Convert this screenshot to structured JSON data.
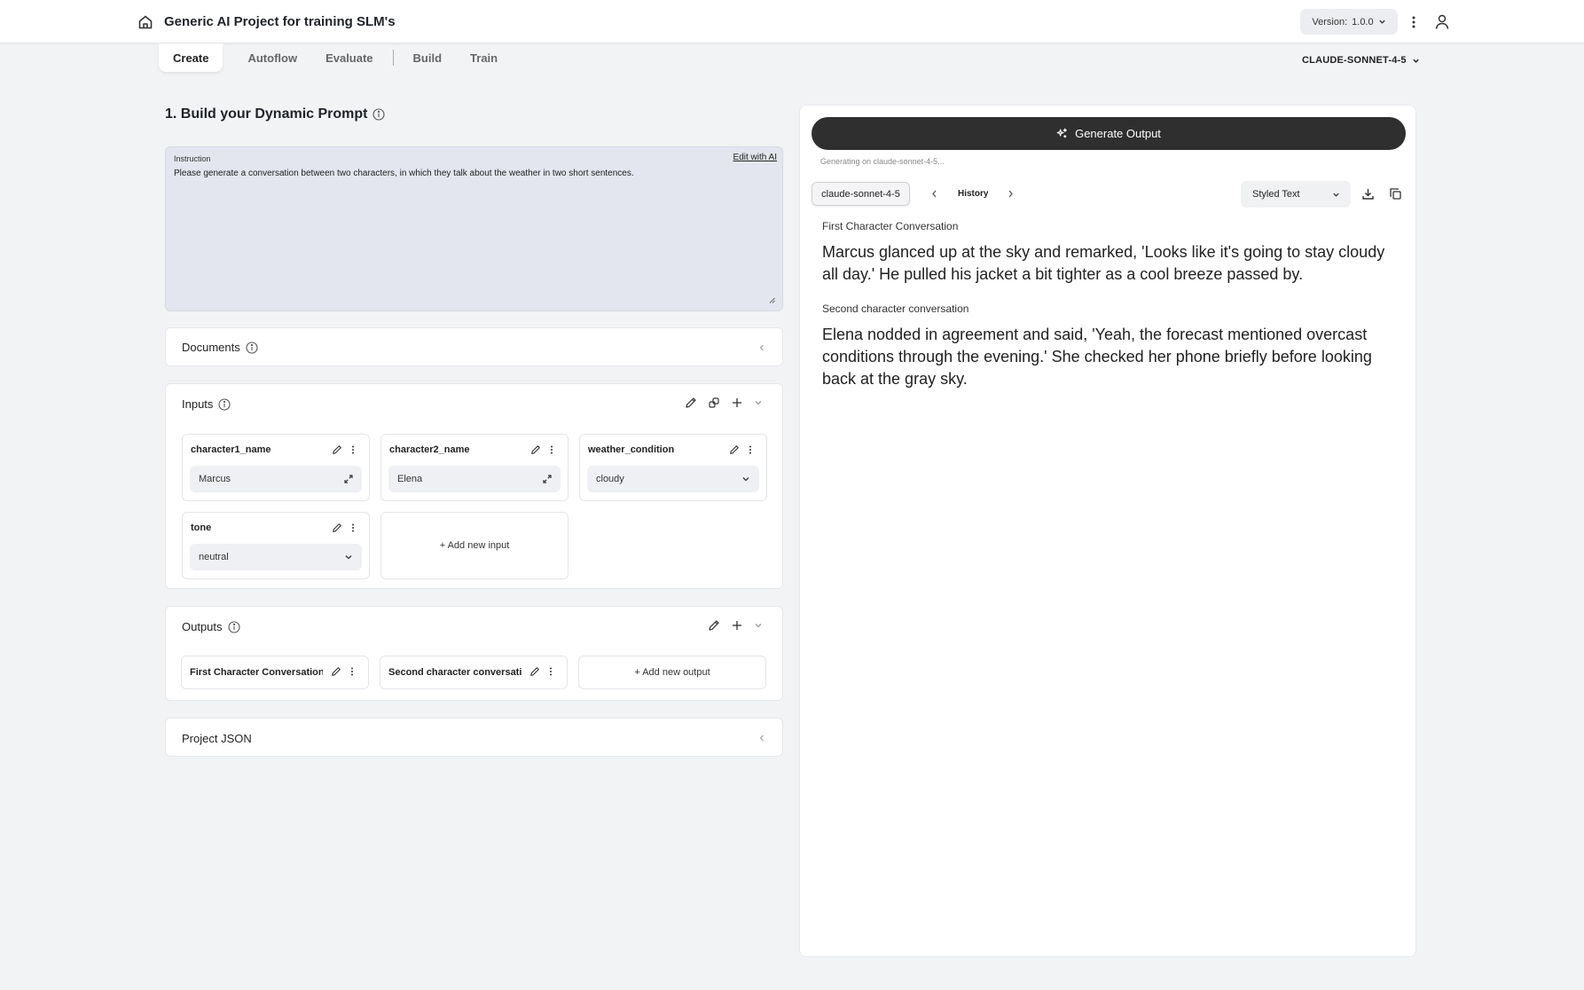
{
  "header": {
    "title": "Generic AI Project for training SLM's",
    "version_label": "Version:",
    "version_value": "1.0.0"
  },
  "tabs": [
    {
      "label": "Create",
      "active": true
    },
    {
      "label": "Autoflow"
    },
    {
      "label": "Evaluate"
    },
    {
      "label": "Build"
    },
    {
      "label": "Train"
    }
  ],
  "model_selector": "CLAUDE-SONNET-4-5",
  "prompt_section": {
    "title": "1. Build your Dynamic Prompt",
    "instruction_label": "Instruction",
    "edit_with_ai": "Edit with AI",
    "instruction_text": "Please generate a conversation between two characters, in which they talk about the weather in two short sentences."
  },
  "documents": {
    "title": "Documents"
  },
  "inputs": {
    "title": "Inputs",
    "items": [
      {
        "name": "character1_name",
        "value": "Marcus",
        "kind": "text"
      },
      {
        "name": "character2_name",
        "value": "Elena",
        "kind": "text"
      },
      {
        "name": "weather_condition",
        "value": "cloudy",
        "kind": "select"
      },
      {
        "name": "tone",
        "value": "neutral",
        "kind": "select"
      }
    ],
    "add_label": "+ Add new input"
  },
  "outputs": {
    "title": "Outputs",
    "items": [
      {
        "name": "First Character Conversation"
      },
      {
        "name": "Second character conversati..."
      }
    ],
    "add_label": "+ Add new output"
  },
  "project_json": {
    "title": "Project JSON"
  },
  "output_panel": {
    "generate_label": "Generate Output",
    "status": "Generating on claude-sonnet-4-5...",
    "model_chip": "claude-sonnet-4-5",
    "history_label": "History",
    "format_value": "Styled Text",
    "sections": [
      {
        "label": "First Character Conversation",
        "text": "Marcus glanced up at the sky and remarked, 'Looks like it's going to stay cloudy all day.' He pulled his jacket a bit tighter as a cool breeze passed by."
      },
      {
        "label": "Second character conversation",
        "text": "Elena nodded in agreement and said, 'Yeah, the forecast mentioned overcast conditions through the evening.' She checked her phone briefly before looking back at the gray sky."
      }
    ]
  },
  "colors": {
    "background": "#f2f3f5",
    "primary_button": "#2f2f2f",
    "instruction_bg": "#e3e6ee"
  },
  "icons": [
    "home-icon",
    "chevron-down-icon",
    "kebab-icon",
    "user-icon",
    "info-icon",
    "chevron-left-icon",
    "pencil-icon",
    "share-icon",
    "plus-icon",
    "expand-icon",
    "sparkle-icon",
    "chevron-right-icon",
    "download-icon",
    "copy-icon",
    "resize-handle-icon"
  ]
}
